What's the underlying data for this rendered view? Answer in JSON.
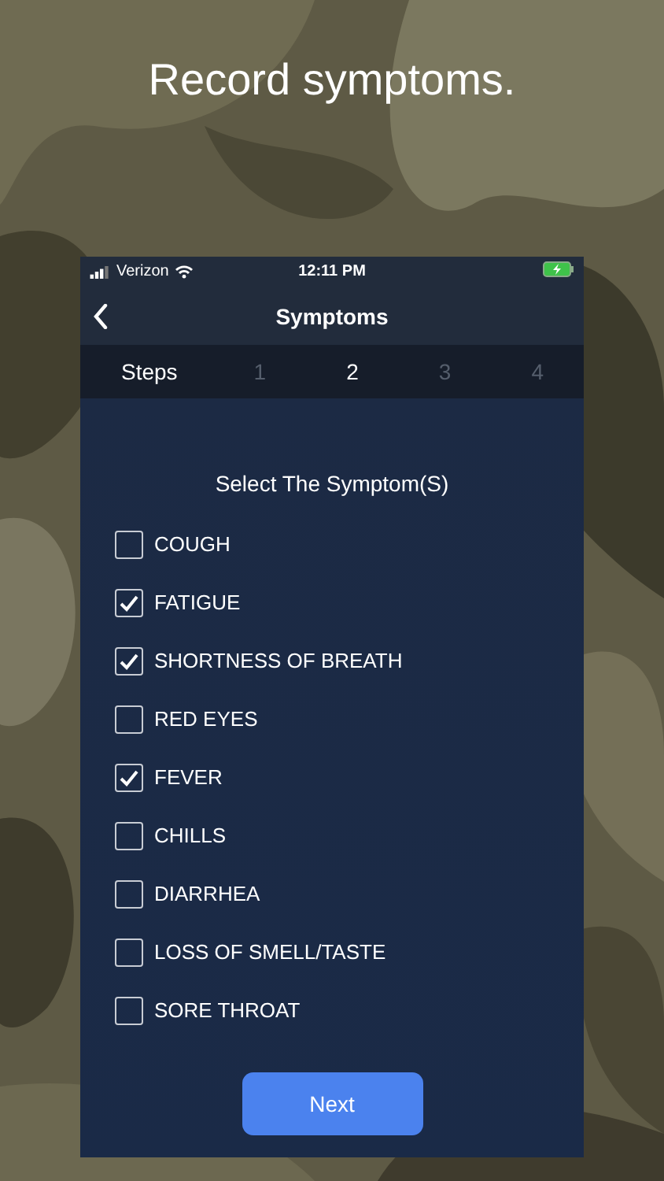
{
  "headline": "Record symptoms.",
  "status_bar": {
    "carrier": "Verizon",
    "time": "12:11 PM"
  },
  "nav": {
    "title": "Symptoms"
  },
  "steps": {
    "label": "Steps",
    "items": [
      {
        "label": "1",
        "selected": false
      },
      {
        "label": "2",
        "selected": true
      },
      {
        "label": "3",
        "selected": false
      },
      {
        "label": "4",
        "selected": false
      }
    ]
  },
  "prompt": "Select The Symptom(S)",
  "symptoms": [
    {
      "label": "COUGH",
      "checked": false
    },
    {
      "label": "FATIGUE",
      "checked": true
    },
    {
      "label": "SHORTNESS OF BREATH",
      "checked": true
    },
    {
      "label": "RED EYES",
      "checked": false
    },
    {
      "label": "FEVER",
      "checked": true
    },
    {
      "label": "CHILLS",
      "checked": false
    },
    {
      "label": "DIARRHEA",
      "checked": false
    },
    {
      "label": "LOSS OF SMELL/TASTE",
      "checked": false
    },
    {
      "label": "SORE THROAT",
      "checked": false
    }
  ],
  "button": "Next"
}
